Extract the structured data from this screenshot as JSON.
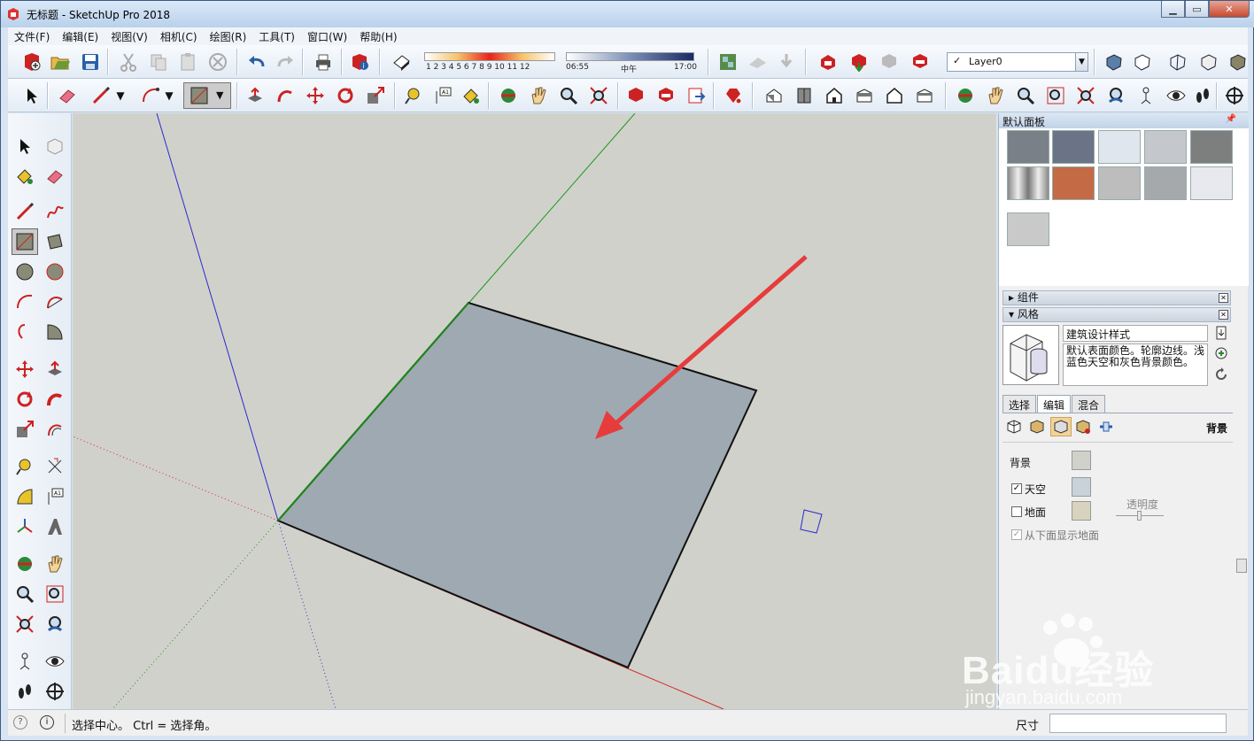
{
  "window": {
    "title": "无标题 - SketchUp Pro 2018"
  },
  "menu": [
    "文件(F)",
    "编辑(E)",
    "视图(V)",
    "相机(C)",
    "绘图(R)",
    "工具(T)",
    "窗口(W)",
    "帮助(H)"
  ],
  "shadow": {
    "months": "1 2 3 4 5 6 7 8 9 10 11 12",
    "time_start": "06:55",
    "time_mid": "中午",
    "time_end": "17:00"
  },
  "layer": {
    "check": "✓",
    "name": "Layer0"
  },
  "panel": {
    "title": "默认面板",
    "components_label": "组件",
    "styles_label": "风格",
    "style_name": "建筑设计样式",
    "style_desc": "默认表面颜色。轮廓边线。浅蓝色天空和灰色背景颜色。",
    "tabs": [
      "选择",
      "编辑",
      "混合"
    ],
    "active_tab": "编辑",
    "section_label": "背景",
    "bg_label": "背景",
    "sky_label": "天空",
    "ground_label": "地面",
    "transparency_label": "透明度",
    "show_ground_below": "从下面显示地面",
    "sky_checked": true,
    "ground_checked": false
  },
  "colors": {
    "background": "#d1d1cb",
    "sky": "#c9d2da",
    "ground": "#d8d3bf",
    "face": "#9fa9b2",
    "arrow": "#e63c3c"
  },
  "swatches": [
    "#7a8088",
    "#6a7486",
    "#dfe6ee",
    "#c4c8cc",
    "#7d7f7f",
    "#9c9c9c",
    "#c46a44",
    "#bdbdbd",
    "#a6a9ac",
    "#e8e9ee",
    "#c9c9c9"
  ],
  "status": {
    "text": "选择中心。 Ctrl = 选择角。",
    "measure_label": "尺寸",
    "measure_value": ""
  },
  "watermark": {
    "brand": "Baidu经验",
    "url": "jingyan.baidu.com"
  }
}
